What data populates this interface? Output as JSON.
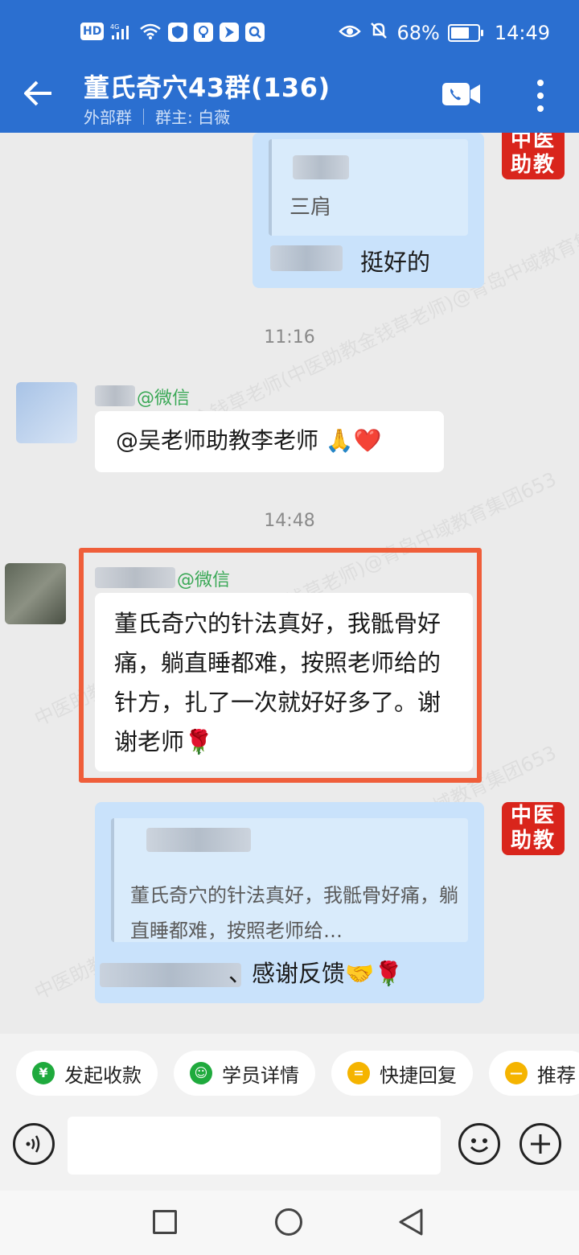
{
  "status_bar": {
    "network_label": "HD",
    "signal_label": "4G",
    "battery_text": "68%",
    "battery_level": 0.68,
    "time": "14:49"
  },
  "header": {
    "title": "董氏奇穴43群(136)",
    "group_type": "外部群",
    "owner": "群主: 白薇"
  },
  "badge": {
    "line1": "中医",
    "line2": "助教"
  },
  "messages": {
    "msg1_quote": "三肩",
    "msg1_text": "挺好的",
    "time1": "11:16",
    "msg2_source": "@微信",
    "msg2_text": "@吴老师助教李老师 🙏❤️",
    "time2": "14:48",
    "msg3_source": "@微信",
    "msg3_text": "董氏奇穴的针法真好，我骶骨好痛，躺直睡都难，按照老师给的针方，扎了一次就好好多了。谢谢老师🌹",
    "msg4_quote": "董氏奇穴的针法真好，我骶骨好痛，躺直睡都难，按照老师给…",
    "msg4_text": "、感谢反馈🤝🌹"
  },
  "watermark_text": "中医助教金钱草老师(中医助教金钱草老师)@青岛中域教育集团653",
  "quick_actions": [
    {
      "label": "发起收款",
      "icon": "payment-shield-icon",
      "color": "#1faa3d"
    },
    {
      "label": "学员详情",
      "icon": "student-profile-icon",
      "color": "#1faa3d"
    },
    {
      "label": "快捷回复",
      "icon": "quick-reply-icon",
      "color": "#f5b400"
    },
    {
      "label": "推荐",
      "icon": "recommend-icon",
      "color": "#f5b400"
    }
  ],
  "input": {
    "placeholder": ""
  }
}
